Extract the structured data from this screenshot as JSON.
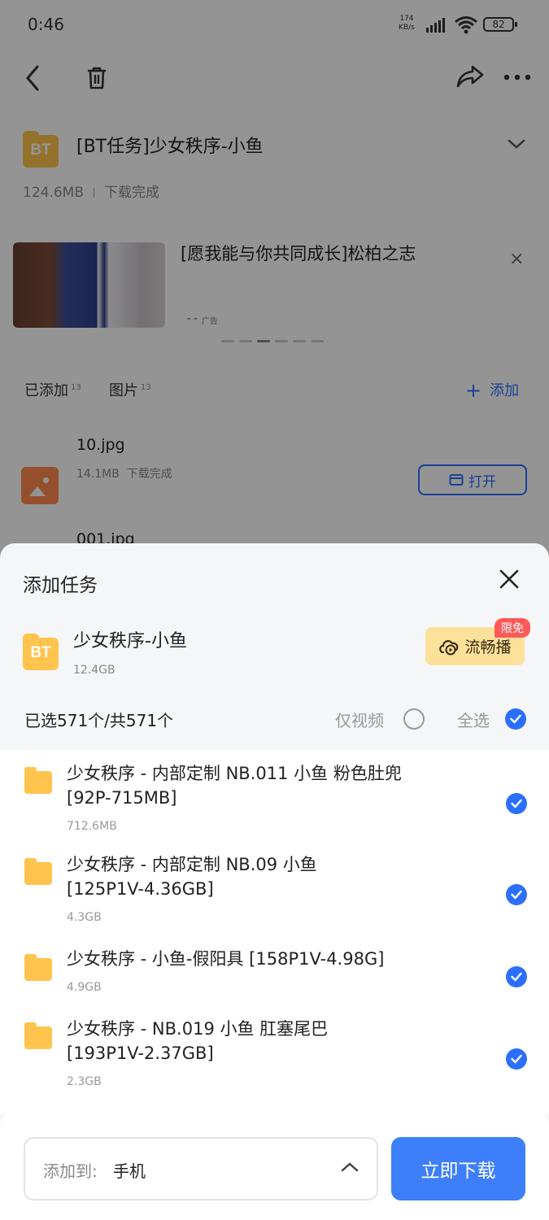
{
  "status_bar": {
    "time": "0:46",
    "net_speed_value": "174",
    "net_speed_unit": "KB/s",
    "battery": "82"
  },
  "header": {
    "back_icon": "chevron-left-icon",
    "delete_icon": "trash-icon",
    "share_icon": "share-icon",
    "more_icon": "more-icon"
  },
  "task": {
    "badge": "BT",
    "title": "[BT任务]少女秩序-小鱼",
    "size": "124.6MB",
    "status": "下载完成"
  },
  "ad": {
    "title": "[愿我能与你共同成长]松柏之志",
    "tag": "广告",
    "close": "×",
    "dot_count": 6,
    "active_dot": 2
  },
  "tabs": [
    {
      "label": "已添加",
      "count": "13"
    },
    {
      "label": "图片",
      "count": "13"
    }
  ],
  "add_label": "添加",
  "files": [
    {
      "name": "10.jpg",
      "size": "14.1MB",
      "status": "下载完成",
      "open_label": "打开"
    },
    {
      "name": "001.jpg"
    }
  ],
  "sheet": {
    "title": "添加任务",
    "folder_badge": "BT",
    "folder_name": "少女秩序-小鱼",
    "folder_size": "12.4GB",
    "smooth_play_label": "流畅播",
    "free_badge": "限免",
    "selected_text": "已选571个/共571个",
    "only_video_label": "仅视频",
    "only_video_checked": false,
    "select_all_label": "全选",
    "select_all_checked": true,
    "items": [
      {
        "line1": "少女秩序 - 内部定制 NB.011 小鱼 粉色肚兜",
        "line2": "[92P-715MB]",
        "size": "712.6MB",
        "checked": true
      },
      {
        "line1": "少女秩序 - 内部定制 NB.09 小鱼",
        "line2": "[125P1V-4.36GB]",
        "size": "4.3GB",
        "checked": true
      },
      {
        "line1": "少女秩序 - 小鱼-假阳具 [158P1V-4.98G]",
        "line2": "",
        "size": "4.9GB",
        "checked": true
      },
      {
        "line1": "少女秩序 - NB.019 小鱼 肛塞尾巴",
        "line2": "[193P1V-2.37GB]",
        "size": "2.3GB",
        "checked": true
      }
    ],
    "destination_label": "添加到:",
    "destination_value": "手机",
    "download_label": "立即下载"
  }
}
